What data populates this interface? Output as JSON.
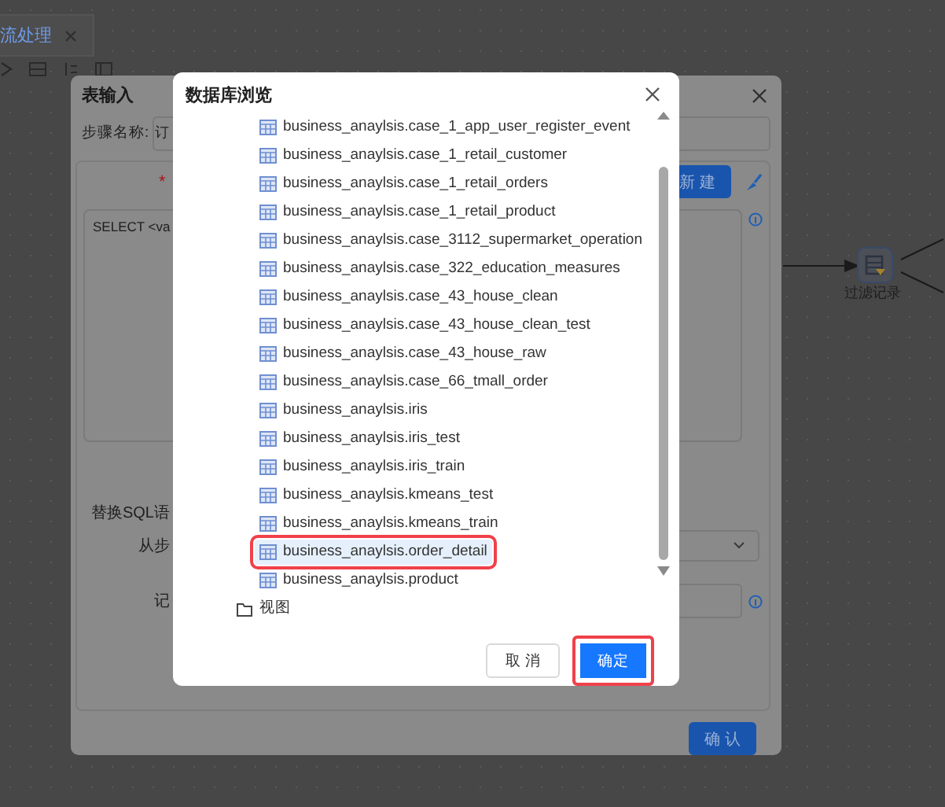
{
  "tab": {
    "label": "流处理"
  },
  "table_input_dialog": {
    "title": "表输入",
    "step_name_label": "步骤名称:",
    "step_name_value": "订",
    "required_mark": "*",
    "new_button": "新 建",
    "sql_value": "SELECT <va",
    "replace_sql_label": "替换SQL语",
    "from_step_label": "从步",
    "record_label": "记",
    "confirm_button": "确 认"
  },
  "canvas": {
    "node_label": "过滤记录"
  },
  "browse_dialog": {
    "title": "数据库浏览",
    "items": [
      {
        "kind": "table",
        "label": "business_anaylsis.case_1_app_user_register_event",
        "selected": false,
        "outlined": false
      },
      {
        "kind": "table",
        "label": "business_anaylsis.case_1_retail_customer",
        "selected": false,
        "outlined": false
      },
      {
        "kind": "table",
        "label": "business_anaylsis.case_1_retail_orders",
        "selected": false,
        "outlined": false
      },
      {
        "kind": "table",
        "label": "business_anaylsis.case_1_retail_product",
        "selected": false,
        "outlined": false
      },
      {
        "kind": "table",
        "label": "business_anaylsis.case_3112_supermarket_operation",
        "selected": false,
        "outlined": false
      },
      {
        "kind": "table",
        "label": "business_anaylsis.case_322_education_measures",
        "selected": false,
        "outlined": false
      },
      {
        "kind": "table",
        "label": "business_anaylsis.case_43_house_clean",
        "selected": false,
        "outlined": false
      },
      {
        "kind": "table",
        "label": "business_anaylsis.case_43_house_clean_test",
        "selected": false,
        "outlined": false
      },
      {
        "kind": "table",
        "label": "business_anaylsis.case_43_house_raw",
        "selected": false,
        "outlined": false
      },
      {
        "kind": "table",
        "label": "business_anaylsis.case_66_tmall_order",
        "selected": false,
        "outlined": false
      },
      {
        "kind": "table",
        "label": "business_anaylsis.iris",
        "selected": false,
        "outlined": false
      },
      {
        "kind": "table",
        "label": "business_anaylsis.iris_test",
        "selected": false,
        "outlined": false
      },
      {
        "kind": "table",
        "label": "business_anaylsis.iris_train",
        "selected": false,
        "outlined": false
      },
      {
        "kind": "table",
        "label": "business_anaylsis.kmeans_test",
        "selected": false,
        "outlined": false
      },
      {
        "kind": "table",
        "label": "business_anaylsis.kmeans_train",
        "selected": false,
        "outlined": false
      },
      {
        "kind": "table",
        "label": "business_anaylsis.order_detail",
        "selected": true,
        "outlined": true
      },
      {
        "kind": "table",
        "label": "business_anaylsis.product",
        "selected": false,
        "outlined": false
      },
      {
        "kind": "folder",
        "label": "视图",
        "selected": false,
        "outlined": false
      }
    ],
    "buttons": [
      {
        "kind": "default",
        "label": "取 消",
        "outlined": false
      },
      {
        "kind": "primary",
        "label": "确定",
        "outlined": true
      }
    ]
  }
}
